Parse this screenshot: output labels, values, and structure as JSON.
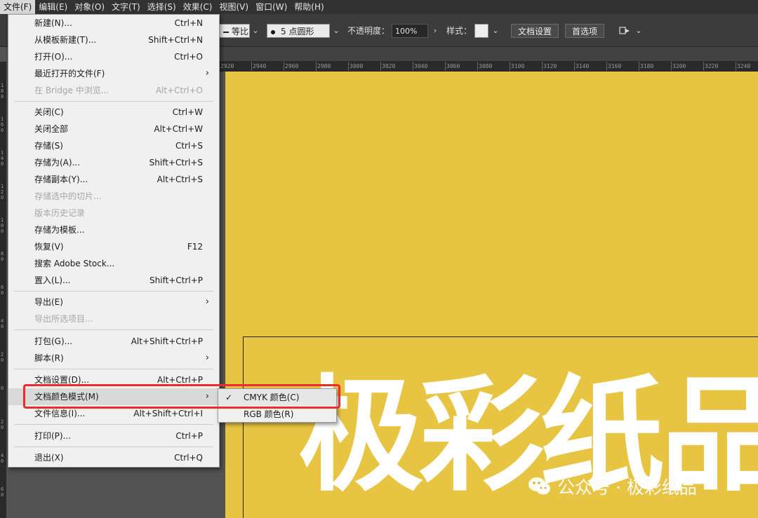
{
  "menubar": {
    "items": [
      {
        "label": "文件(F)"
      },
      {
        "label": "编辑(E)"
      },
      {
        "label": "对象(O)"
      },
      {
        "label": "文字(T)"
      },
      {
        "label": "选择(S)"
      },
      {
        "label": "效果(C)"
      },
      {
        "label": "视图(V)"
      },
      {
        "label": "窗口(W)"
      },
      {
        "label": "帮助(H)"
      }
    ]
  },
  "controlbar": {
    "stroke_profile": "等比",
    "brush": "5 点圆形",
    "opacity_label": "不透明度：",
    "opacity_value": "100%",
    "style_label": "样式：",
    "doc_setup_button": "文档设置",
    "prefs_button": "首选项"
  },
  "ruler": {
    "top_ticks": [
      "2920",
      "2940",
      "2960",
      "2980",
      "3000",
      "3020",
      "3040",
      "3060",
      "3080",
      "3100",
      "3120",
      "3140",
      "3160",
      "3180",
      "3200",
      "3220",
      "3240"
    ],
    "left_ticks": [
      "1\n8\n0",
      "1\n6\n0",
      "1\n4\n0",
      "1\n2\n0",
      "1\n0\n0",
      "8\n0",
      "6\n0",
      "4\n0",
      "2\n0",
      "0",
      "2\n0",
      "4\n0",
      "6\n0"
    ]
  },
  "file_menu": {
    "items": [
      {
        "label": "新建(N)...",
        "shortcut": "Ctrl+N"
      },
      {
        "label": "从模板新建(T)...",
        "shortcut": "Shift+Ctrl+N"
      },
      {
        "label": "打开(O)...",
        "shortcut": "Ctrl+O"
      },
      {
        "label": "最近打开的文件(F)",
        "shortcut": ""
      },
      {
        "label": "在 Bridge 中浏览...",
        "shortcut": "Alt+Ctrl+O"
      },
      {
        "label": "关闭(C)",
        "shortcut": "Ctrl+W"
      },
      {
        "label": "关闭全部",
        "shortcut": "Alt+Ctrl+W"
      },
      {
        "label": "存储(S)",
        "shortcut": "Ctrl+S"
      },
      {
        "label": "存储为(A)...",
        "shortcut": "Shift+Ctrl+S"
      },
      {
        "label": "存储副本(Y)...",
        "shortcut": "Alt+Ctrl+S"
      },
      {
        "label": "存储选中的切片...",
        "shortcut": ""
      },
      {
        "label": "版本历史记录",
        "shortcut": ""
      },
      {
        "label": "存储为模板...",
        "shortcut": ""
      },
      {
        "label": "恢复(V)",
        "shortcut": "F12"
      },
      {
        "label": "搜索 Adobe Stock...",
        "shortcut": ""
      },
      {
        "label": "置入(L)...",
        "shortcut": "Shift+Ctrl+P"
      },
      {
        "label": "导出(E)",
        "shortcut": ""
      },
      {
        "label": "导出所选项目...",
        "shortcut": ""
      },
      {
        "label": "打包(G)...",
        "shortcut": "Alt+Shift+Ctrl+P"
      },
      {
        "label": "脚本(R)",
        "shortcut": ""
      },
      {
        "label": "文档设置(D)...",
        "shortcut": "Alt+Ctrl+P"
      },
      {
        "label": "文档颜色模式(M)",
        "shortcut": ""
      },
      {
        "label": "文件信息(I)...",
        "shortcut": "Alt+Shift+Ctrl+I"
      },
      {
        "label": "打印(P)...",
        "shortcut": "Ctrl+P"
      },
      {
        "label": "退出(X)",
        "shortcut": "Ctrl+Q"
      }
    ]
  },
  "color_mode_submenu": {
    "items": [
      {
        "label": "CMYK 颜色(C)",
        "checked": true
      },
      {
        "label": "RGB 颜色(R)",
        "checked": false
      }
    ]
  },
  "artboard": {
    "headline": "极彩纸品",
    "background_color": "#e8c443"
  },
  "watermark": {
    "text": "公众号 · 极彩纸品"
  },
  "annotation": {
    "color": "#ec2b2b"
  }
}
